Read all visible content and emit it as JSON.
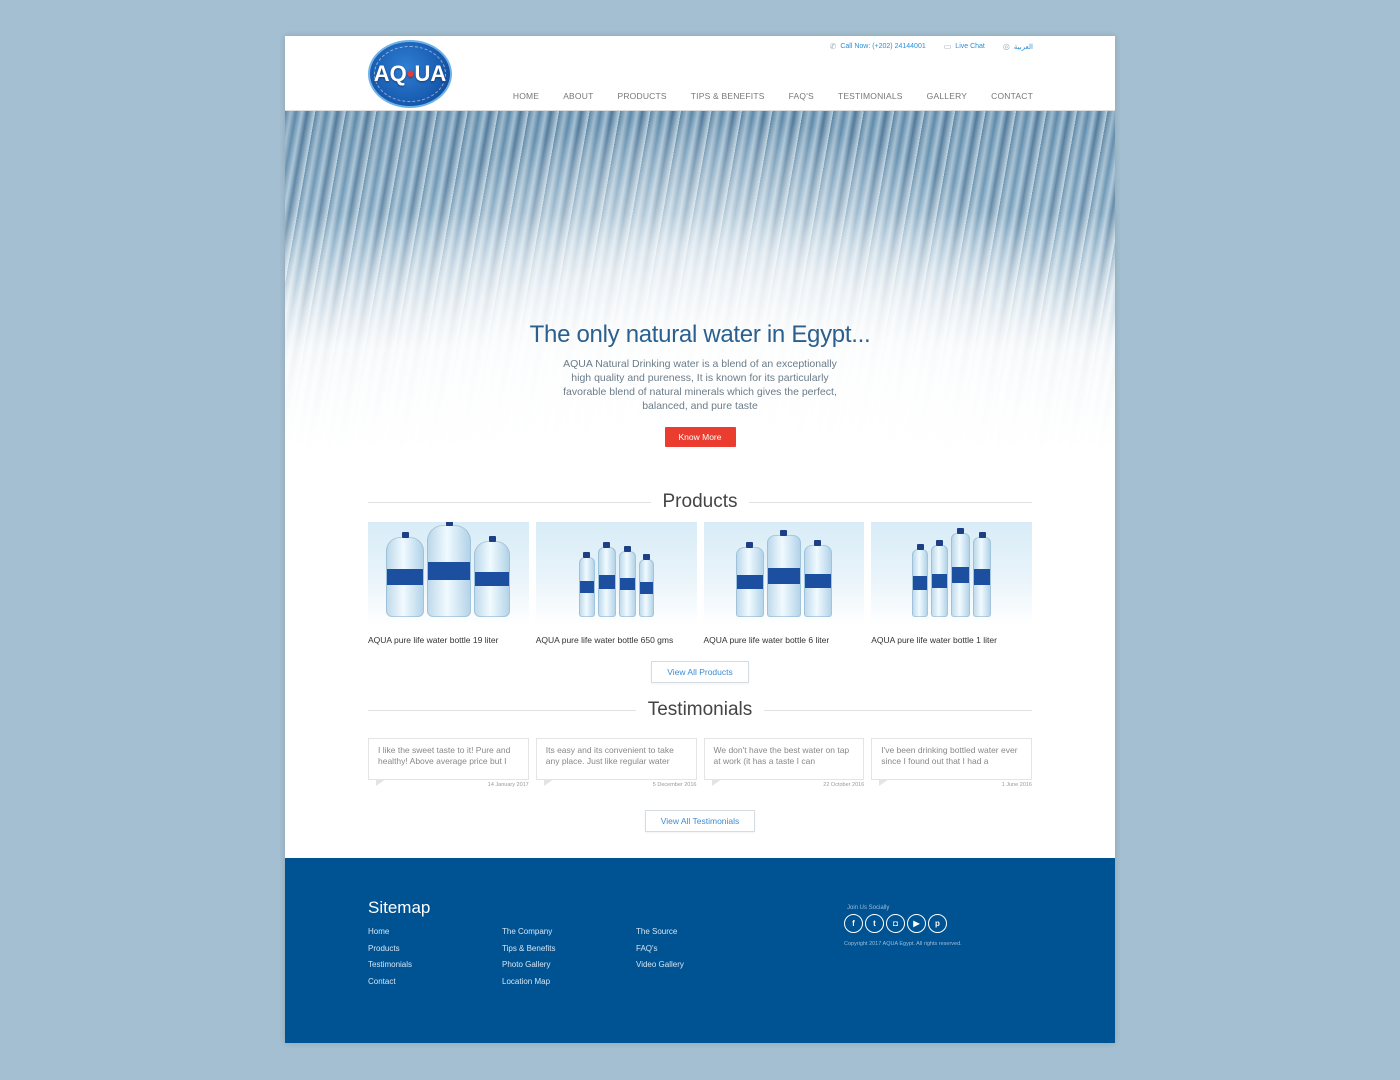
{
  "header": {
    "logo_text": "AQUA",
    "call": "Call Now: (+202) 24144001",
    "live_chat": "Live Chat",
    "language": "العربية",
    "nav": [
      "HOME",
      "ABOUT",
      "PRODUCTS",
      "TIPS & BENEFITS",
      "FAQ'S",
      "TESTIMONIALS",
      "GALLERY",
      "CONTACT"
    ]
  },
  "hero": {
    "title": "The only natural water in Egypt...",
    "text": "AQUA Natural Drinking water is a blend of an exceptionally high quality and pureness, It is known for its particularly favorable blend of natural minerals which gives the perfect, balanced, and pure taste",
    "button": "Know More"
  },
  "products": {
    "title": "Products",
    "items": [
      {
        "name": "AQUA pure life water bottle 19 liter",
        "image": "bottles-19l"
      },
      {
        "name": "AQUA pure life water bottle 650 gms",
        "image": "bottles-650"
      },
      {
        "name": "AQUA pure life water bottle 6 liter",
        "image": "bottles-6l"
      },
      {
        "name": "AQUA pure life water bottle 1 liter",
        "image": "bottles-1l"
      }
    ],
    "view_all": "View All Products"
  },
  "testimonials": {
    "title": "Testimonials",
    "items": [
      {
        "text": "I like the sweet taste to it! Pure and healthy! Above average price but I",
        "date": "14 January 2017"
      },
      {
        "text": "Its easy and its convenient to take any place. Just like regular water",
        "date": "5 December 2016"
      },
      {
        "text": "We don't have the best water on tap at work (it has a taste I can",
        "date": "22 October 2016"
      },
      {
        "text": "I've been drinking bottled water ever since I found out that I had a",
        "date": "1 June 2016"
      }
    ],
    "view_all": "View All Testimonials"
  },
  "footer": {
    "sitemap_title": "Sitemap",
    "columns": [
      [
        "Home",
        "Products",
        "Testimonials",
        "Contact"
      ],
      [
        "The Company",
        "Tips & Benefits",
        "Photo Gallery",
        "Location Map"
      ],
      [
        "The Source",
        "FAQ's",
        "Video Gallery"
      ]
    ],
    "join": "Join Us Socially",
    "social": [
      "facebook-icon",
      "twitter-icon",
      "instagram-icon",
      "youtube-icon",
      "pinterest-icon"
    ],
    "copyright": "Copyright 2017 AQUA Egypt. All rights reserved.",
    "color": "#005393"
  },
  "colors": {
    "accent": "#ea3d2f",
    "link": "#3d8bd4",
    "title": "#2c5f8d"
  }
}
